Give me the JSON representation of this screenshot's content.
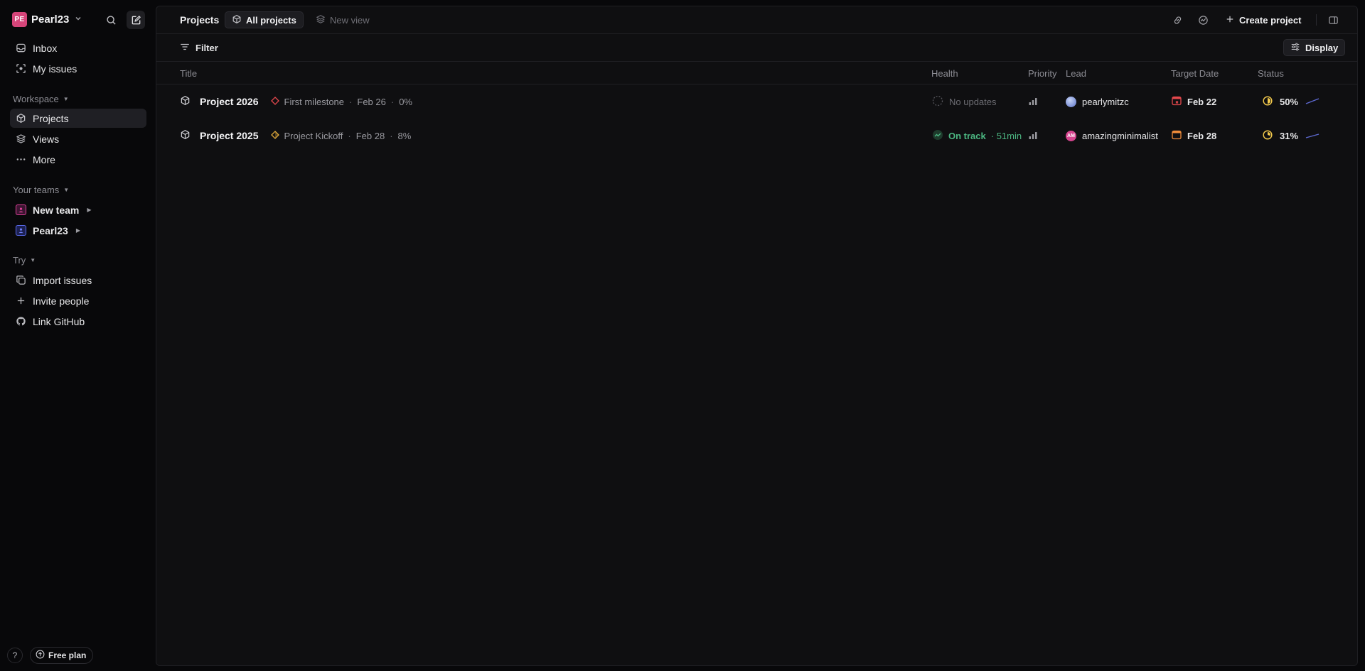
{
  "workspace": {
    "initials": "PE",
    "name": "Pearl23"
  },
  "sidebar": {
    "nav": [
      {
        "label": "Inbox",
        "icon": "inbox-icon"
      },
      {
        "label": "My issues",
        "icon": "my-issues-icon"
      }
    ],
    "workspace_header": "Workspace",
    "workspace_items": [
      {
        "label": "Projects",
        "icon": "cube-icon",
        "active": true
      },
      {
        "label": "Views",
        "icon": "layers-icon"
      },
      {
        "label": "More",
        "icon": "more-icon"
      }
    ],
    "teams_header": "Your teams",
    "teams": [
      {
        "label": "New team",
        "color": "#e0409a"
      },
      {
        "label": "Pearl23",
        "color": "#5a6cf0"
      }
    ],
    "try_header": "Try",
    "try_items": [
      {
        "label": "Import issues",
        "icon": "import-icon"
      },
      {
        "label": "Invite people",
        "icon": "plus-icon"
      },
      {
        "label": "Link GitHub",
        "icon": "github-icon"
      }
    ],
    "help_label": "?",
    "plan_label": "Free plan"
  },
  "toolbar": {
    "breadcrumb": "Projects",
    "tab_all": "All projects",
    "tab_new": "New view",
    "create_label": "Create project"
  },
  "filterbar": {
    "filter_label": "Filter",
    "display_label": "Display"
  },
  "table": {
    "headers": {
      "title": "Title",
      "health": "Health",
      "priority": "Priority",
      "lead": "Lead",
      "target": "Target Date",
      "status": "Status"
    },
    "rows": [
      {
        "title": "Project 2026",
        "milestone": "First milestone",
        "milestone_date": "Feb 26",
        "milestone_pct": "0%",
        "milestone_color": "#e5484d",
        "health": "No updates",
        "health_type": "none",
        "lead": "pearlymitzc",
        "lead_initials": "",
        "lead_color": "#7b8fd6",
        "target": "Feb 22",
        "target_color": "#e5484d",
        "status": "50%",
        "status_progress": 0.5
      },
      {
        "title": "Project 2025",
        "milestone": "Project Kickoff",
        "milestone_date": "Feb 28",
        "milestone_pct": "8%",
        "milestone_color": "#e0a93a",
        "health": "On track",
        "health_time": "· 51min",
        "health_type": "ok",
        "lead": "amazingminimalist",
        "lead_initials": "AM",
        "lead_color": "#d6458f",
        "target": "Feb 28",
        "target_color": "#f08c3a",
        "status": "31%",
        "status_progress": 0.31
      }
    ]
  }
}
